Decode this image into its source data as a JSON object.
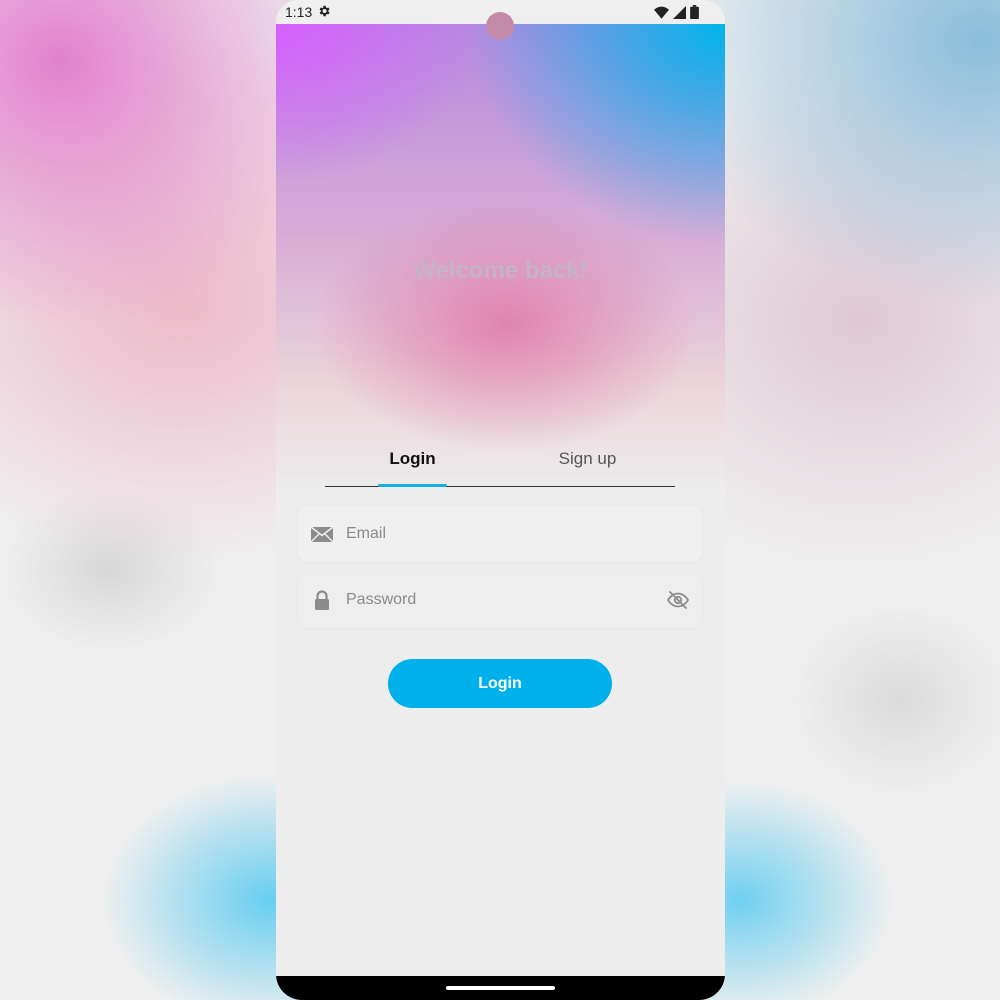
{
  "status_bar": {
    "time": "1:13",
    "settings_icon": "gear-icon",
    "wifi_icon": "wifi-icon",
    "signal_icon": "signal-icon",
    "battery_icon": "battery-icon"
  },
  "header": {
    "title": "Welcome back!"
  },
  "tabs": [
    {
      "label": "Login",
      "selected": true
    },
    {
      "label": "Sign up",
      "selected": false
    }
  ],
  "form": {
    "email": {
      "placeholder": "Email",
      "value": "",
      "icon": "mail-icon"
    },
    "password": {
      "placeholder": "Password",
      "value": "",
      "icon": "lock-icon",
      "toggle_icon": "eye-off-icon"
    },
    "submit_label": "Login"
  },
  "colors": {
    "accent": "#00b0ea",
    "header_gradient_start": "#d65fff",
    "header_gradient_end": "#00b4eb",
    "background": "#ededed"
  }
}
